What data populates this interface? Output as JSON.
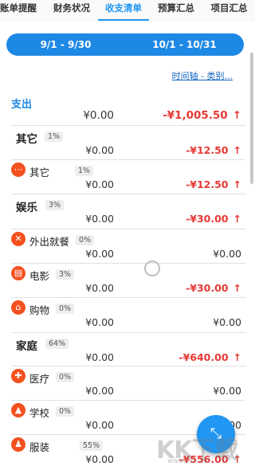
{
  "tabs": [
    "账单提醒",
    "财务状况",
    "收支清单",
    "预算汇总",
    "项目汇总"
  ],
  "periods": [
    "9/1 - 9/30",
    "10/1 - 10/31"
  ],
  "timeline_link": "时间轴 - 类别...",
  "section": {
    "title": "支出",
    "total_prev": "¥0.00",
    "total_curr": "-¥1,005.50",
    "total_arrow": "↑"
  },
  "rows": [
    {
      "name": "其它",
      "pct": "1%",
      "prev": "¥0.00",
      "curr": "-¥12.50",
      "arrow": "↑"
    },
    {
      "name": "其它",
      "pct": "1%",
      "prev": "¥0.00",
      "curr": "-¥12.50",
      "arrow": "↑",
      "icon": "more-icon"
    },
    {
      "name": "娱乐",
      "pct": "3%",
      "prev": "¥0.00",
      "curr": "-¥30.00",
      "arrow": "↑"
    },
    {
      "name": "外出就餐",
      "pct": "0%",
      "prev": "¥0.00",
      "curr": "¥0.00",
      "arrow": "",
      "icon": "utensils-icon"
    },
    {
      "name": "电影",
      "pct": "3%",
      "prev": "¥0.00",
      "curr": "-¥30.00",
      "arrow": "↑",
      "icon": "film-icon"
    },
    {
      "name": "购物",
      "pct": "0%",
      "prev": "¥0.00",
      "curr": "¥0.00",
      "arrow": "",
      "icon": "shopping-basket-icon"
    },
    {
      "name": "家庭",
      "pct": "64%",
      "prev": "¥0.00",
      "curr": "-¥640.00",
      "arrow": "↑"
    },
    {
      "name": "医疗",
      "pct": "0%",
      "prev": "¥0.00",
      "curr": "¥0.00",
      "arrow": "",
      "icon": "medical-icon"
    },
    {
      "name": "学校",
      "pct": "0%",
      "prev": "¥0.00",
      "curr": "¥0.00",
      "arrow": "",
      "icon": "graduation-cap-icon"
    },
    {
      "name": "服装",
      "pct": "55%",
      "prev": "¥0.00",
      "curr": "-¥556.00",
      "arrow": "↑",
      "icon": "clothing-icon"
    }
  ],
  "fab_icon": "expand-icon",
  "watermark": {
    "main": "KK下载",
    "sub": "www.kkx.net"
  },
  "colors": {
    "accent": "#1e88e5",
    "negative": "#e53935",
    "icon_bg": "#f4511e"
  }
}
